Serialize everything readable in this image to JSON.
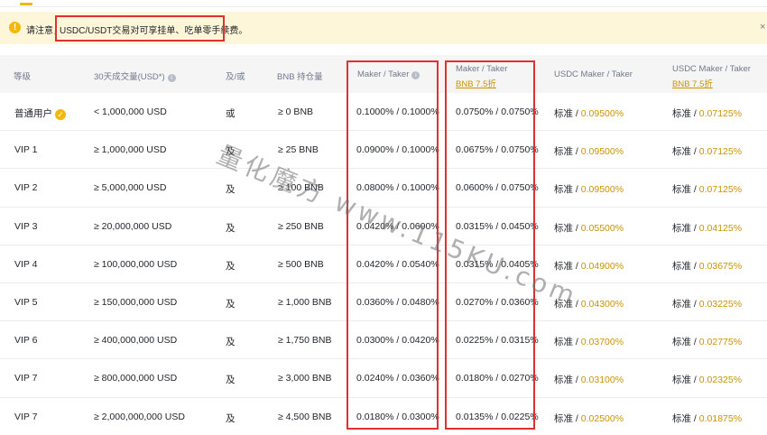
{
  "notice": {
    "prefix": "请注意，",
    "text": "USDC/USDT交易对可享挂单、吃单零手续费。",
    "close": "×"
  },
  "table": {
    "headers": {
      "level": "等级",
      "volume": "30天成交量(USD*)",
      "andor": "及/或",
      "bnb": "BNB 持仓量",
      "maker_taker": "Maker / Taker",
      "maker_taker_bnb": "Maker / Taker",
      "bnb_discount": "BNB 7.5折",
      "usdc_maker_taker": "USDC Maker / Taker",
      "usdc_maker_taker_bnb": "USDC Maker / Taker",
      "usdc_bnb_discount": "BNB 7.5折"
    },
    "rows": [
      {
        "level": "普通用户",
        "volume": "< 1,000,000 USD",
        "andor": "或",
        "bnb": "≥ 0 BNB",
        "fee": "0.1000% / 0.1000%",
        "fee_bnb": "0.0750% / 0.0750%",
        "usdc_std": "标准 / ",
        "usdc_val": "0.09500%",
        "usdc_bnb_std": "标准 / ",
        "usdc_bnb_val": "0.07125%"
      },
      {
        "level": "VIP 1",
        "volume": "≥ 1,000,000 USD",
        "andor": "及",
        "bnb": "≥ 25 BNB",
        "fee": "0.0900% / 0.1000%",
        "fee_bnb": "0.0675% / 0.0750%",
        "usdc_std": "标准 / ",
        "usdc_val": "0.09500%",
        "usdc_bnb_std": "标准 / ",
        "usdc_bnb_val": "0.07125%"
      },
      {
        "level": "VIP 2",
        "volume": "≥ 5,000,000 USD",
        "andor": "及",
        "bnb": "≥ 100 BNB",
        "fee": "0.0800% / 0.1000%",
        "fee_bnb": "0.0600% / 0.0750%",
        "usdc_std": "标准 / ",
        "usdc_val": "0.09500%",
        "usdc_bnb_std": "标准 / ",
        "usdc_bnb_val": "0.07125%"
      },
      {
        "level": "VIP 3",
        "volume": "≥ 20,000,000 USD",
        "andor": "及",
        "bnb": "≥ 250 BNB",
        "fee": "0.0420% / 0.0600%",
        "fee_bnb": "0.0315% / 0.0450%",
        "usdc_std": "标准 / ",
        "usdc_val": "0.05500%",
        "usdc_bnb_std": "标准 / ",
        "usdc_bnb_val": "0.04125%"
      },
      {
        "level": "VIP 4",
        "volume": "≥ 100,000,000 USD",
        "andor": "及",
        "bnb": "≥ 500 BNB",
        "fee": "0.0420% / 0.0540%",
        "fee_bnb": "0.0315% / 0.0405%",
        "usdc_std": "标准 / ",
        "usdc_val": "0.04900%",
        "usdc_bnb_std": "标准 / ",
        "usdc_bnb_val": "0.03675%"
      },
      {
        "level": "VIP 5",
        "volume": "≥ 150,000,000 USD",
        "andor": "及",
        "bnb": "≥ 1,000 BNB",
        "fee": "0.0360% / 0.0480%",
        "fee_bnb": "0.0270% / 0.0360%",
        "usdc_std": "标准 / ",
        "usdc_val": "0.04300%",
        "usdc_bnb_std": "标准 / ",
        "usdc_bnb_val": "0.03225%"
      },
      {
        "level": "VIP 6",
        "volume": "≥ 400,000,000 USD",
        "andor": "及",
        "bnb": "≥ 1,750 BNB",
        "fee": "0.0300% / 0.0420%",
        "fee_bnb": "0.0225% / 0.0315%",
        "usdc_std": "标准 / ",
        "usdc_val": "0.03700%",
        "usdc_bnb_std": "标准 / ",
        "usdc_bnb_val": "0.02775%"
      },
      {
        "level": "VIP 7",
        "volume": "≥ 800,000,000 USD",
        "andor": "及",
        "bnb": "≥ 3,000 BNB",
        "fee": "0.0240% / 0.0360%",
        "fee_bnb": "0.0180% / 0.0270%",
        "usdc_std": "标准 / ",
        "usdc_val": "0.03100%",
        "usdc_bnb_std": "标准 / ",
        "usdc_bnb_val": "0.02325%"
      },
      {
        "level": "VIP 7",
        "volume": "≥ 2,000,000,000 USD",
        "andor": "及",
        "bnb": "≥ 4,500 BNB",
        "fee": "0.0180% / 0.0300%",
        "fee_bnb": "0.0135% / 0.0225%",
        "usdc_std": "标准 / ",
        "usdc_val": "0.02500%",
        "usdc_bnb_std": "标准 / ",
        "usdc_bnb_val": "0.01875%"
      }
    ]
  },
  "watermark": "量化魔方 www.115KU.com",
  "colors": {
    "accent": "#f0b90b",
    "highlight": "#e03131",
    "gold_text": "#c99400",
    "notice_bg": "#fef6d8"
  }
}
